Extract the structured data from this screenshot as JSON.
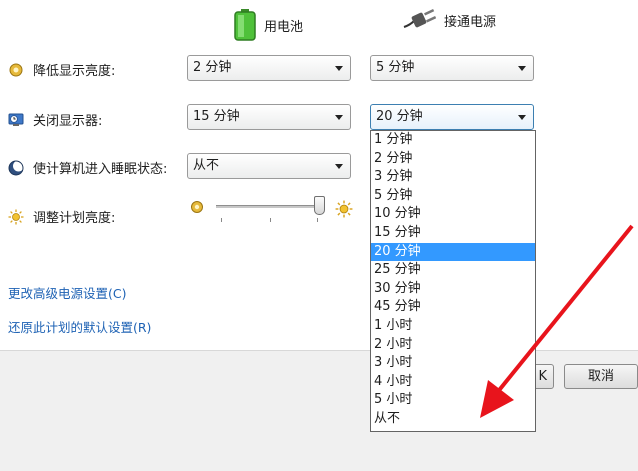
{
  "columns": {
    "battery": {
      "label": "用电池",
      "icon": "battery-icon"
    },
    "plugged": {
      "label": "接通电源",
      "icon": "power-plug-icon"
    }
  },
  "rows": {
    "dim": {
      "label": "降低显示亮度:",
      "battery": "2 分钟",
      "plugged": "5 分钟"
    },
    "off": {
      "label": "关闭显示器:",
      "battery": "15 分钟",
      "plugged": "20 分钟"
    },
    "sleep": {
      "label": "使计算机进入睡眠状态:",
      "battery": "从不"
    },
    "brightness": {
      "label": "调整计划亮度:"
    }
  },
  "dropdown_options": [
    "1 分钟",
    "2 分钟",
    "3 分钟",
    "5 分钟",
    "10 分钟",
    "15 分钟",
    "20 分钟",
    "25 分钟",
    "30 分钟",
    "45 分钟",
    "1 小时",
    "2 小时",
    "3 小时",
    "4 小时",
    "5 小时",
    "从不"
  ],
  "dropdown_selected_index": 6,
  "links": {
    "advanced": "更改高级电源设置(C)",
    "restore": "还原此计划的默认设置(R)"
  },
  "buttons": {
    "save_partial": "K",
    "cancel": "取消"
  },
  "brightness_level": 0.98,
  "colors": {
    "selection": "#3399ff",
    "link": "#1e62b4",
    "arrow": "#e8141c"
  }
}
